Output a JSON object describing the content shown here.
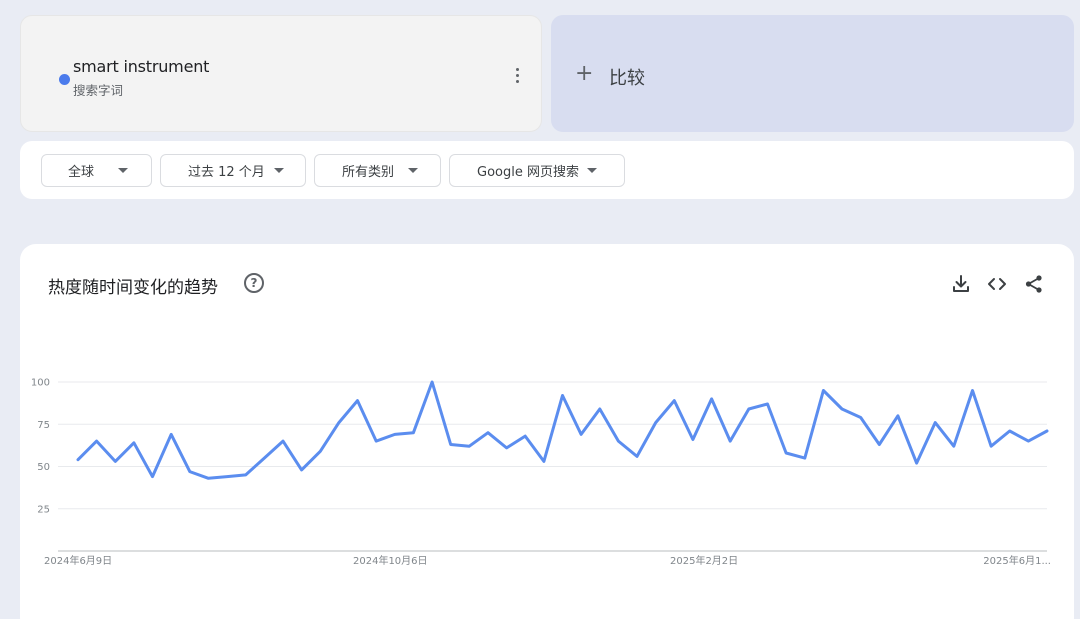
{
  "search_term": {
    "name": "smart instrument",
    "type": "搜索字词",
    "color": "#4b7bec"
  },
  "compare": {
    "label": "比较"
  },
  "filters": [
    {
      "label": "全球"
    },
    {
      "label": "过去 12 个月"
    },
    {
      "label": "所有类别"
    },
    {
      "label": "Google 网页搜索"
    }
  ],
  "chart": {
    "title": "热度随时间变化的趋势",
    "help_icon": "help-icon",
    "tools": [
      "download-icon",
      "embed-code-icon",
      "share-icon"
    ]
  },
  "chart_data": {
    "type": "line",
    "y_ticks": [
      25,
      50,
      75,
      100
    ],
    "ylim": [
      0,
      100
    ],
    "x_tick_labels": [
      "2024年6月9日",
      "2024年10月6日",
      "2025年2月2日",
      "2025年6月1..."
    ],
    "grid": true,
    "series": [
      {
        "color": "#5b8def",
        "values": [
          54,
          65,
          53,
          64,
          44,
          69,
          47,
          43,
          44,
          45,
          55,
          65,
          48,
          59,
          76,
          89,
          65,
          69,
          70,
          100,
          63,
          62,
          70,
          61,
          68,
          53,
          92,
          69,
          84,
          65,
          56,
          76,
          89,
          66,
          90,
          65,
          84,
          87,
          58,
          55,
          95,
          84,
          79,
          63,
          80,
          52,
          76,
          62,
          95,
          62,
          71,
          65,
          71
        ]
      }
    ]
  }
}
